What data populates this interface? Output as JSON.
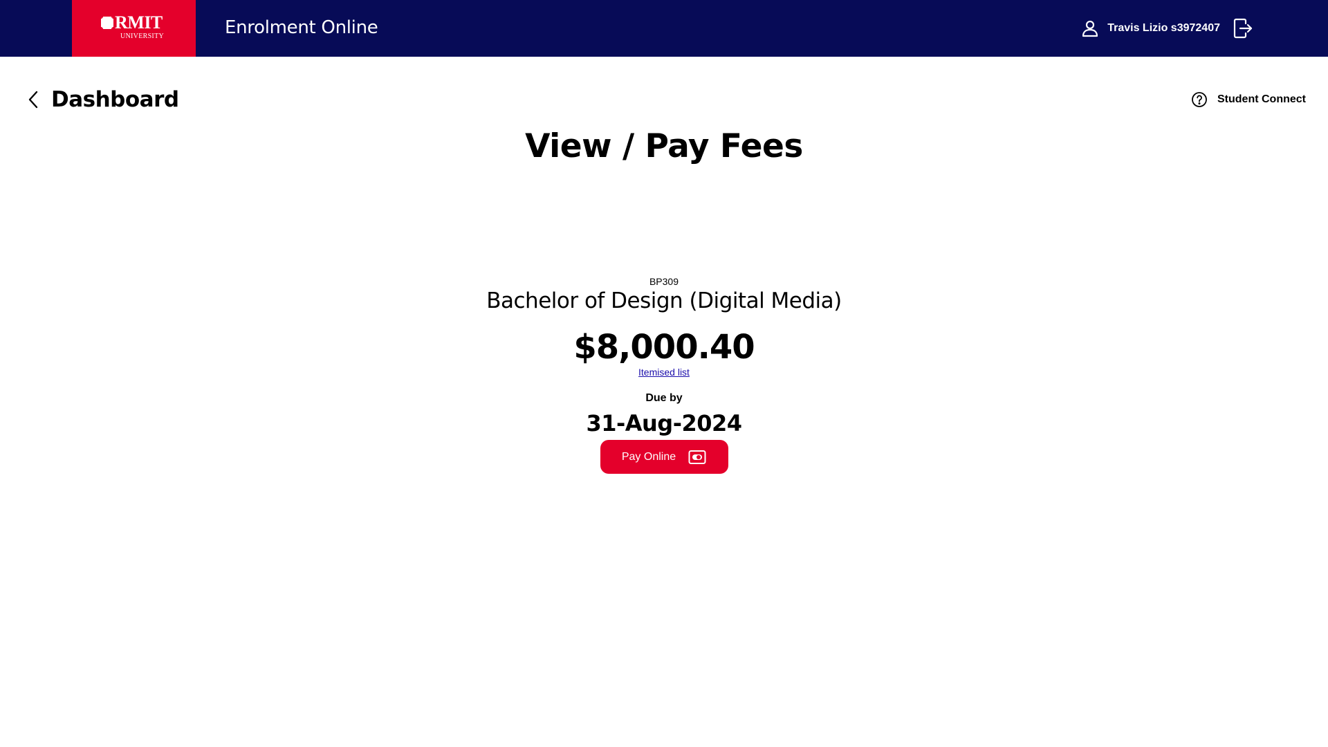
{
  "header": {
    "logo_main": "RMIT",
    "logo_sub": "UNIVERSITY",
    "app_title": "Enrolment Online",
    "user_name": "Travis Lizio s3972407",
    "icons": {
      "user": "user-icon",
      "logout": "logout-icon"
    }
  },
  "nav": {
    "back_label": "Dashboard",
    "back_icon": "chevron-left-icon",
    "help_label": "Student Connect",
    "help_icon": "question-circle-icon"
  },
  "page": {
    "title": "View / Pay Fees"
  },
  "fee": {
    "program_code": "BP309",
    "program_name": "Bachelor of Design (Digital Media)",
    "amount": "$8,000.40",
    "itemised_link": "Itemised list",
    "due_label": "Due by",
    "due_date": "31-Aug-2024",
    "pay_button": "Pay Online",
    "pay_icon": "payment-card-icon"
  },
  "colors": {
    "header_bg": "#070b57",
    "brand_red": "#e4002b",
    "link": "#1a0dab"
  }
}
